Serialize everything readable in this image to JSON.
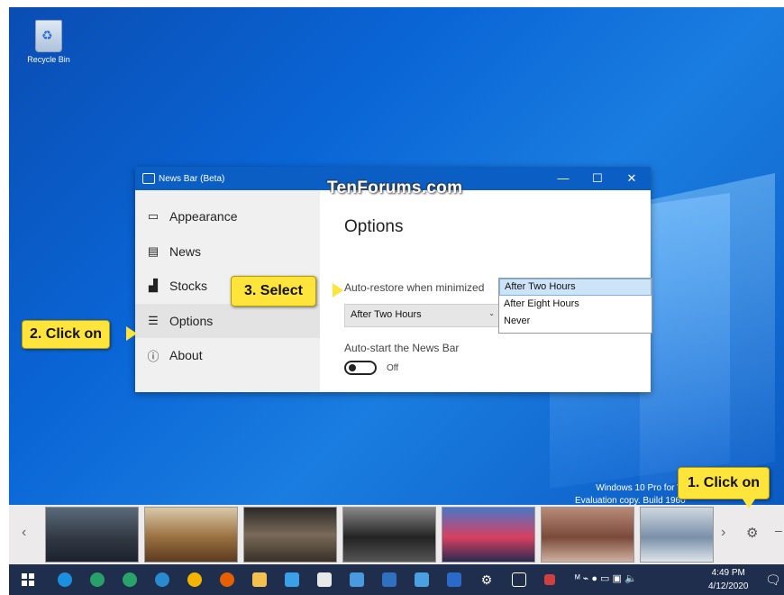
{
  "desktop": {
    "recycle_bin_label": "Recycle Bin",
    "watermark": "TenForums.com",
    "eval_line1": "Windows 10 Pro for W",
    "eval_line2": "Evaluation copy. Build 1960"
  },
  "window": {
    "title": "News Bar (Beta)",
    "minimize": "—",
    "maximize": "☐",
    "close": "✕"
  },
  "sidebar": {
    "items": [
      {
        "label": "Appearance",
        "icon": "monitor-icon"
      },
      {
        "label": "News",
        "icon": "newspaper-icon"
      },
      {
        "label": "Stocks",
        "icon": "stocks-chart-icon"
      },
      {
        "label": "Options",
        "icon": "sliders-icon"
      },
      {
        "label": "About",
        "icon": "question-circle-icon"
      }
    ],
    "selected": "Options"
  },
  "content": {
    "heading": "Options",
    "auto_restore_label": "Auto-restore when minimized",
    "auto_restore_value": "After Two Hours",
    "auto_start_label": "Auto-start the News Bar",
    "auto_start_state": "Off"
  },
  "dropdown": {
    "options": [
      "After Two Hours",
      "After Eight Hours",
      "Never"
    ],
    "highlighted": "After Two Hours"
  },
  "callouts": {
    "step1": "1. Click on",
    "step2": "2. Click on",
    "step3": "3. Select"
  },
  "news_bar": {
    "thumbnails": [
      "person-in-suit",
      "church-interior",
      "auditorium",
      "car",
      "boat-in-water",
      "city-street-night",
      "meat-market",
      "lab-worker"
    ]
  },
  "taskbar": {
    "time": "4:49 PM",
    "date": "4/12/2020"
  },
  "colors": {
    "accent": "#0a5ec4",
    "callout": "#ffe53b",
    "taskbar": "#1f2e4d"
  }
}
